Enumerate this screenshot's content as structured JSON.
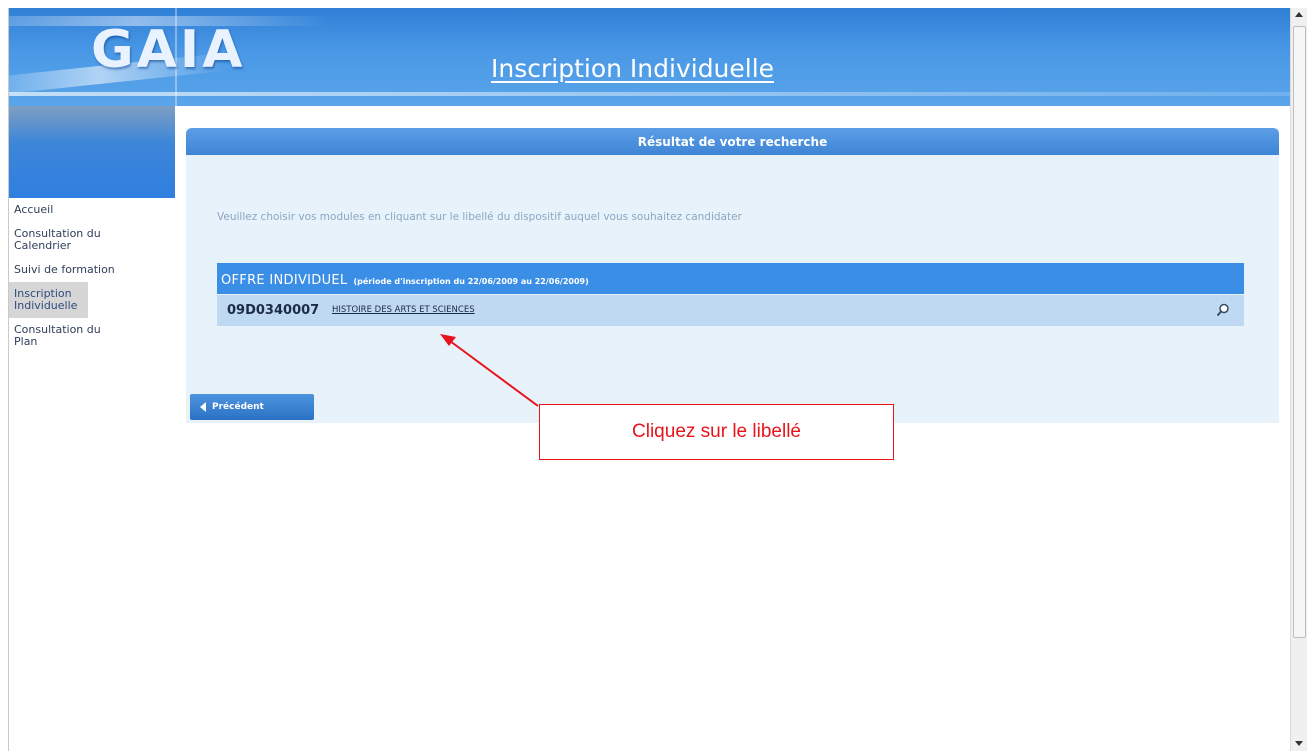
{
  "header": {
    "logo": "GAIA",
    "title": "Inscription Individuelle"
  },
  "nav": {
    "items": [
      {
        "label": "Accueil"
      },
      {
        "label": "Consultation du Calendrier"
      },
      {
        "label": "Suivi de formation"
      },
      {
        "label": "Inscription Individuelle"
      },
      {
        "label": "Consultation du Plan"
      }
    ],
    "active_index": 3
  },
  "panel": {
    "title": "Résultat de votre recherche",
    "instruction": "Veuillez choisir vos modules en cliquant sur le libellé du dispositif auquel vous souhaitez candidater",
    "offer": {
      "title": "OFFRE INDIVIDUEL",
      "period": "(période d'inscription du 22/06/2009 au 22/06/2009)"
    },
    "module": {
      "code": "09D0340007",
      "label": "HISTOIRE DES ARTS ET SCIENCES",
      "action_icon": "magnifier-icon"
    },
    "back_button": "Précédent"
  },
  "annotation": {
    "text": "Cliquez sur le libellé",
    "color": "#e8141c"
  },
  "colors": {
    "header_blue": "#3a8ee6",
    "panel_background": "#e8f2fb",
    "row_background": "#bfd9f2"
  }
}
